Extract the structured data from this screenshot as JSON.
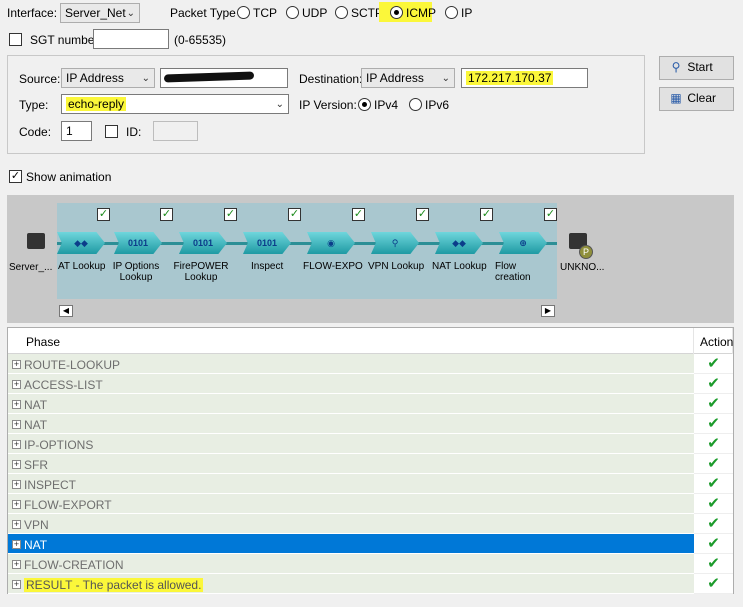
{
  "interface": {
    "label": "Interface:",
    "value": "Server_Net"
  },
  "packet_type": {
    "label": "Packet Type",
    "options": [
      {
        "label": "TCP",
        "checked": false
      },
      {
        "label": "UDP",
        "checked": false
      },
      {
        "label": "SCTP",
        "checked": false
      },
      {
        "label": "ICMP",
        "checked": true
      },
      {
        "label": "IP",
        "checked": false
      }
    ]
  },
  "sgt": {
    "label": "SGT number",
    "value": "",
    "range": "(0-65535)"
  },
  "source": {
    "label": "Source:",
    "type": "IP Address",
    "value": ""
  },
  "destination": {
    "label": "Destination:",
    "type": "IP Address",
    "value": "172.217.170.37"
  },
  "type": {
    "label": "Type:",
    "value": "echo-reply"
  },
  "ip_version": {
    "label": "IP Version:",
    "options": [
      {
        "label": "IPv4",
        "checked": true
      },
      {
        "label": "IPv6",
        "checked": false
      }
    ]
  },
  "code": {
    "label": "Code:",
    "value": "1"
  },
  "id": {
    "label": "ID:",
    "value": ""
  },
  "buttons": {
    "start": "Start",
    "clear": "Clear"
  },
  "show_animation": {
    "label": "Show animation",
    "checked": true
  },
  "animation": {
    "source_node": "Server_...",
    "dest_node": "UNKNO...",
    "phases": [
      {
        "label": "NAT Lookup",
        "display": "AT Lookup",
        "icon": "nat-icon"
      },
      {
        "label": "IP Options Lookup",
        "icon": "ip-options-icon"
      },
      {
        "label": "FirePOWER Lookup",
        "icon": "firepower-icon"
      },
      {
        "label": "Inspect",
        "icon": "inspect-icon"
      },
      {
        "label": "FLOW-EXPO",
        "icon": "flow-export-icon"
      },
      {
        "label": "VPN Lookup",
        "icon": "vpn-icon"
      },
      {
        "label": "NAT Lookup",
        "icon": "nat-icon"
      },
      {
        "label": "Flow creation",
        "icon": "flow-creation-icon"
      }
    ]
  },
  "table": {
    "headers": {
      "phase": "Phase",
      "action": "Action"
    },
    "rows": [
      {
        "phase": "ROUTE-LOOKUP",
        "action": "allow"
      },
      {
        "phase": "ACCESS-LIST",
        "action": "allow"
      },
      {
        "phase": "NAT",
        "action": "allow"
      },
      {
        "phase": "NAT",
        "action": "allow"
      },
      {
        "phase": "IP-OPTIONS",
        "action": "allow"
      },
      {
        "phase": "SFR",
        "action": "allow"
      },
      {
        "phase": "INSPECT",
        "action": "allow"
      },
      {
        "phase": "FLOW-EXPORT",
        "action": "allow"
      },
      {
        "phase": "VPN",
        "action": "allow"
      },
      {
        "phase": "NAT",
        "action": "allow",
        "selected": true
      },
      {
        "phase": "FLOW-CREATION",
        "action": "allow"
      },
      {
        "phase": "RESULT - The packet is allowed.",
        "action": "allow",
        "highlight": true
      }
    ]
  },
  "colors": {
    "selection": "#0078d7",
    "highlight": "#fbf73a",
    "allow": "#1c9b2b",
    "pipeline": "#a9c7cf"
  }
}
